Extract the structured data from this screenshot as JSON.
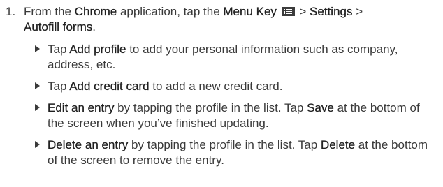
{
  "step": {
    "number": "1.",
    "p1": "From the ",
    "chrome": "Chrome",
    "p2": " application, tap the ",
    "menu_key": "Menu Key",
    "p3": " > ",
    "settings": "Settings",
    "p4": " >",
    "autofill": "Autofill forms",
    "p5": "."
  },
  "bullets": [
    {
      "pre": "Tap ",
      "bold": "Add profile",
      "post": " to add your personal information such as company, address, etc."
    },
    {
      "pre": "Tap ",
      "bold": "Add credit card",
      "post": " to add a new credit card."
    },
    {
      "bold": "Edit an entry",
      "mid": " by tapping the profile in the list. Tap ",
      "bold2": "Save",
      "post": " at the bottom of the screen when you’ve finished updating."
    },
    {
      "bold": "Delete an entry",
      "mid": " by tapping the profile in the list. Tap ",
      "bold2": "Delete",
      "post": " at the bottom of the screen to remove the entry."
    }
  ],
  "icons": {
    "menu_key": "menu-key-icon",
    "bullet": "triangle-bullet-icon"
  }
}
